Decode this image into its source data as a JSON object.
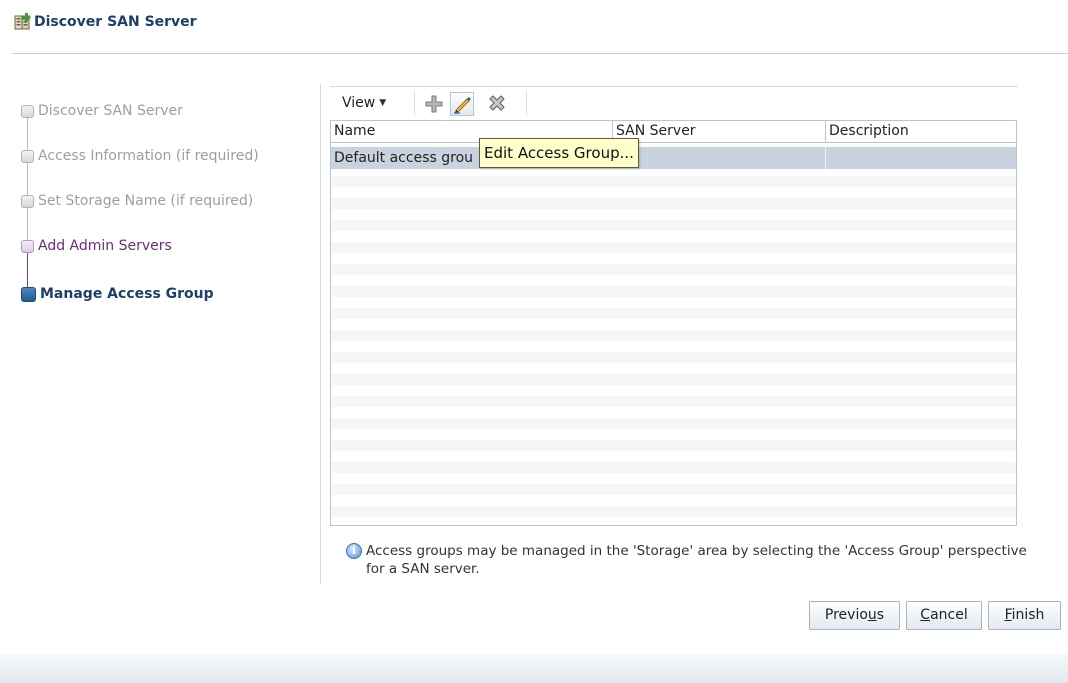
{
  "dialog": {
    "title": "Discover SAN Server",
    "icon": "storage-add-icon"
  },
  "train": {
    "steps": [
      {
        "label": "Discover SAN Server",
        "state": "disabled"
      },
      {
        "label": "Access Information (if required)",
        "state": "disabled"
      },
      {
        "label": "Set Storage Name (if required)",
        "state": "disabled"
      },
      {
        "label": "Add Admin Servers",
        "state": "visited"
      },
      {
        "label": "Manage Access Group",
        "state": "current"
      }
    ]
  },
  "toolbar": {
    "view_label": "View",
    "icons": [
      "add-icon",
      "edit-icon",
      "delete-icon"
    ],
    "tooltip": "Edit Access Group..."
  },
  "table": {
    "columns": [
      "Name",
      "SAN Server",
      "Description"
    ],
    "rows": [
      {
        "name": "Default access grou",
        "san_server": "",
        "description": ""
      }
    ]
  },
  "info": {
    "text": "Access groups may be managed in the 'Storage' area by selecting the 'Access Group' perspective for a SAN server."
  },
  "buttons": {
    "previous": {
      "before": "Previo",
      "mnemonic": "u",
      "after": "s"
    },
    "cancel": {
      "before": "",
      "mnemonic": "C",
      "after": "ancel"
    },
    "finish": {
      "before": "",
      "mnemonic": "F",
      "after": "inish"
    }
  },
  "colors": {
    "accent": "#1e3f6a",
    "visited": "#6b2d7a",
    "highlight": "#e02020",
    "tooltip_bg": "#ffffcc"
  }
}
